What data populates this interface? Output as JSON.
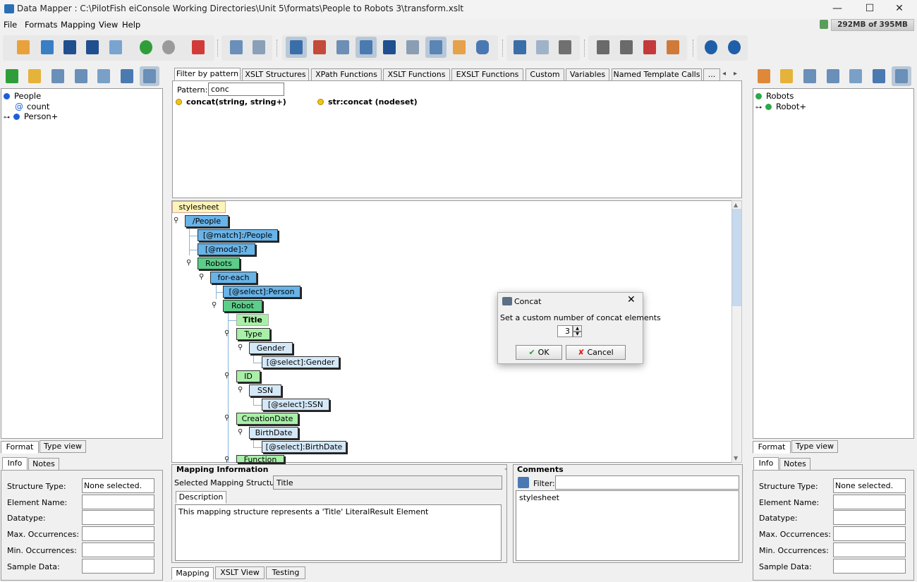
{
  "window": {
    "title": "Data Mapper : C:\\PilotFish eiConsole Working Directories\\Unit 5\\formats\\People to Robots 3\\transform.xslt",
    "minimize": "—",
    "maximize": "☐",
    "close": "✕"
  },
  "menu": [
    "File",
    "Formats",
    "Mapping",
    "View",
    "Help"
  ],
  "memory": "292MB of 395MB",
  "source_tree": {
    "items": [
      {
        "label": "People",
        "icon": "blue-dot"
      },
      {
        "label": "count",
        "icon": "at-icon"
      },
      {
        "label": "Person+",
        "icon": "blue-dot"
      }
    ]
  },
  "target_tree": {
    "items": [
      {
        "label": "Robots",
        "icon": "green-dot"
      },
      {
        "label": "Robot+",
        "icon": "green-dot"
      }
    ]
  },
  "left_bottom_tabs": [
    "Format",
    "Type view"
  ],
  "right_bottom_tabs": [
    "Format",
    "Type view"
  ],
  "info_tabs": [
    "Info",
    "Notes"
  ],
  "info_labels": [
    "Structure Type:",
    "Element Name:",
    "Datatype:",
    "Max. Occurrences:",
    "Min. Occurrences:",
    "Sample Data:"
  ],
  "left_info_values": [
    "None selected.",
    "",
    "",
    "",
    "",
    ""
  ],
  "right_info_values": [
    "None selected.",
    "",
    "",
    "",
    "",
    ""
  ],
  "function_tabs": [
    "Filter by pattern",
    "XSLT Structures",
    "XPath Functions",
    "XSLT Functions",
    "EXSLT Functions",
    "Custom",
    "Variables",
    "Named Template Calls",
    "...",
    "◂",
    "▸"
  ],
  "pattern": {
    "label": "Pattern:",
    "value": "conc"
  },
  "functions": [
    "concat(string, string+)",
    "str:concat (nodeset)"
  ],
  "mapping_nodes": {
    "stylesheet": "stylesheet",
    "people": "/People",
    "match": "[@match]:/People",
    "mode": "[@mode]:?",
    "robots": "Robots",
    "foreach": "for-each",
    "select_person": "[@select]:Person",
    "robot": "Robot",
    "title": "Title",
    "type": "Type",
    "gender": "Gender",
    "select_gender": "[@select]:Gender",
    "id": "ID",
    "ssn": "SSN",
    "select_ssn": "[@select]:SSN",
    "creation_date": "CreationDate",
    "birth_date": "BirthDate",
    "select_birthdate": "[@select]:BirthDate",
    "function": "Function"
  },
  "mapping_info": {
    "heading": "Mapping Information",
    "selected_label": "Selected Mapping Structure:",
    "selected_value": "Title",
    "description_tab": "Description",
    "description": "This mapping structure represents a 'Title' LiteralResult Element"
  },
  "comments": {
    "heading": "Comments",
    "filter_label": "Filter:",
    "filter_value": "",
    "items": [
      "stylesheet"
    ]
  },
  "center_bottom_tabs": [
    "Mapping",
    "XSLT View",
    "Testing"
  ],
  "dialog": {
    "title": "Concat",
    "message": "Set a custom number of concat elements",
    "value": "3",
    "ok": "OK",
    "cancel": "Cancel"
  },
  "colors": {
    "source_node": "#68b3e8",
    "target_node": "#5ccd8a",
    "target_light": "#a8f0a8",
    "source_light": "#d4e8f8",
    "selection": "#b9c8d8"
  }
}
